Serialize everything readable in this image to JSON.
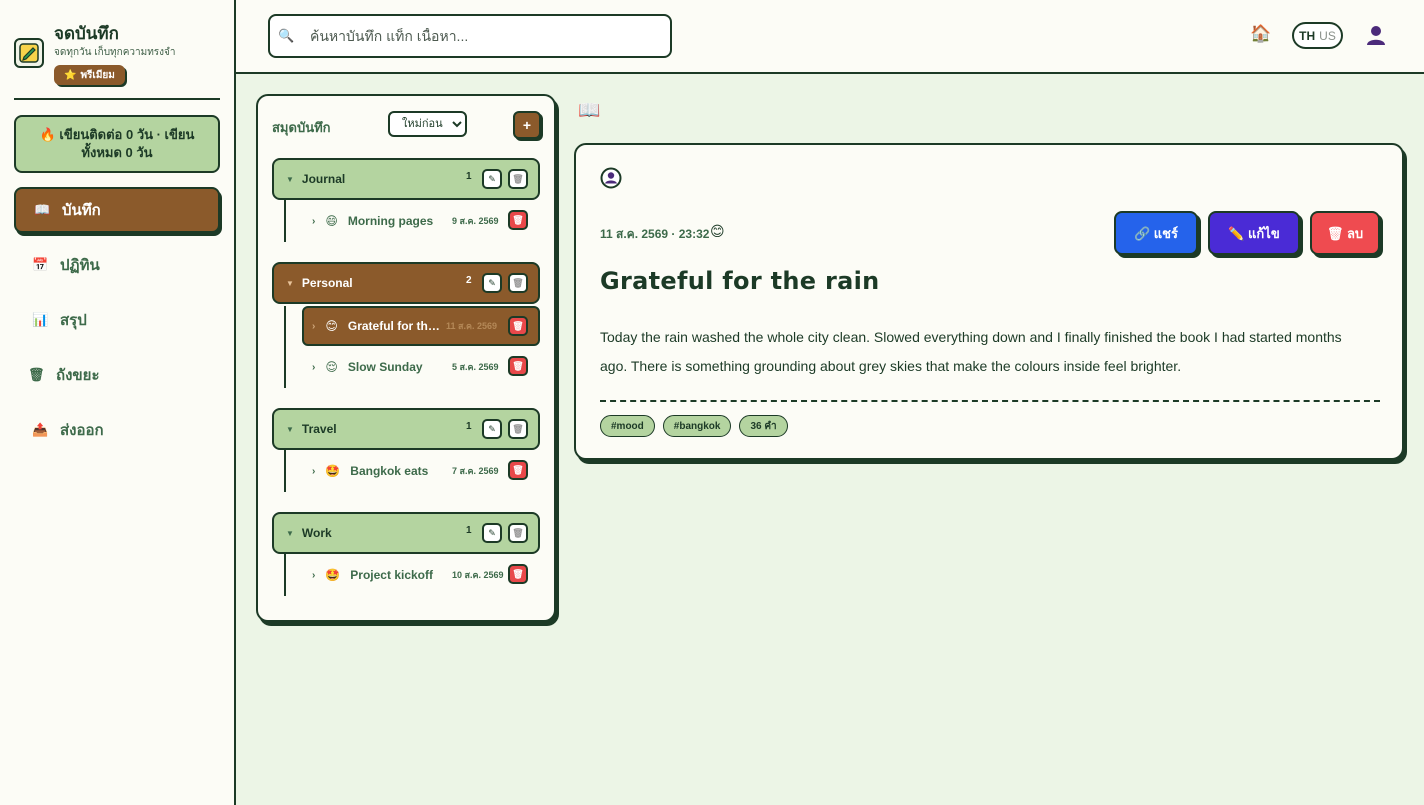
{
  "brand": {
    "title": "จดบันทึก",
    "subtitle": "จดทุกวัน เก็บทุกความทรงจำ",
    "premium_label": "พรีเมียม"
  },
  "streak": {
    "line1": "🔥 เขียนติดต่อ 0 วัน · เขียน",
    "line2": "ทั้งหมด 0 วัน"
  },
  "nav": {
    "items": [
      {
        "label": "บันทึก",
        "icon": "📖",
        "active": true
      },
      {
        "label": "ปฏิทิน",
        "icon": "📅",
        "active": false
      },
      {
        "label": "สรุป",
        "icon": "📊",
        "active": false
      },
      {
        "label": "ถังขยะ",
        "icon": "🗑",
        "active": false
      },
      {
        "label": "ส่งออก",
        "icon": "📤",
        "active": false
      }
    ]
  },
  "header": {
    "search_placeholder": "ค้นหาบันทึก แท็ก เนื้อหา...",
    "lang_active": "TH",
    "lang_inactive": "US"
  },
  "notebooks": {
    "title": "สมุดบันทึก",
    "sort_selected": "ใหม่ก่อน",
    "add_label": "+",
    "groups": [
      {
        "name": "Journal",
        "count": "1",
        "active": false,
        "notes": [
          {
            "emoji": "😄",
            "title": "Morning pages",
            "date": "9 ส.ค. 2569",
            "active": false
          }
        ]
      },
      {
        "name": "Personal",
        "count": "2",
        "active": true,
        "notes": [
          {
            "emoji": "😊",
            "title": "Grateful for the rain",
            "date": "11 ส.ค. 2569",
            "active": true
          },
          {
            "emoji": "😌",
            "title": "Slow Sunday",
            "date": "5 ส.ค. 2569",
            "active": false
          }
        ]
      },
      {
        "name": "Travel",
        "count": "1",
        "active": false,
        "notes": [
          {
            "emoji": "🤩",
            "title": "Bangkok eats",
            "date": "7 ส.ค. 2569",
            "active": false
          }
        ]
      },
      {
        "name": "Work",
        "count": "1",
        "active": false,
        "notes": [
          {
            "emoji": "🤩",
            "title": "Project kickoff",
            "date": "10 ส.ค. 2569",
            "active": false
          }
        ]
      }
    ]
  },
  "note": {
    "datetime": "11 ส.ค. 2569 · 23:32",
    "mood": "😊",
    "title": "Grateful for the rain",
    "body": "Today the rain washed the whole city clean. Slowed everything down and I finally finished the book I had started months ago. There is something grounding about grey skies that make the colours inside feel brighter.",
    "share_label": "🔗 แชร์",
    "edit_label": "✏️ แก้ไข",
    "delete_label": "🗑 ลบ",
    "tags": [
      "#mood",
      "#bangkok",
      "36 คำ"
    ]
  },
  "colors": {
    "ink": "#1c3a26",
    "accent_brown": "#8b5a2b",
    "sage": "#b4d4a0",
    "share_blue": "#2563eb",
    "edit_purple": "#4a2bd6",
    "delete_red": "#ef4b50"
  }
}
